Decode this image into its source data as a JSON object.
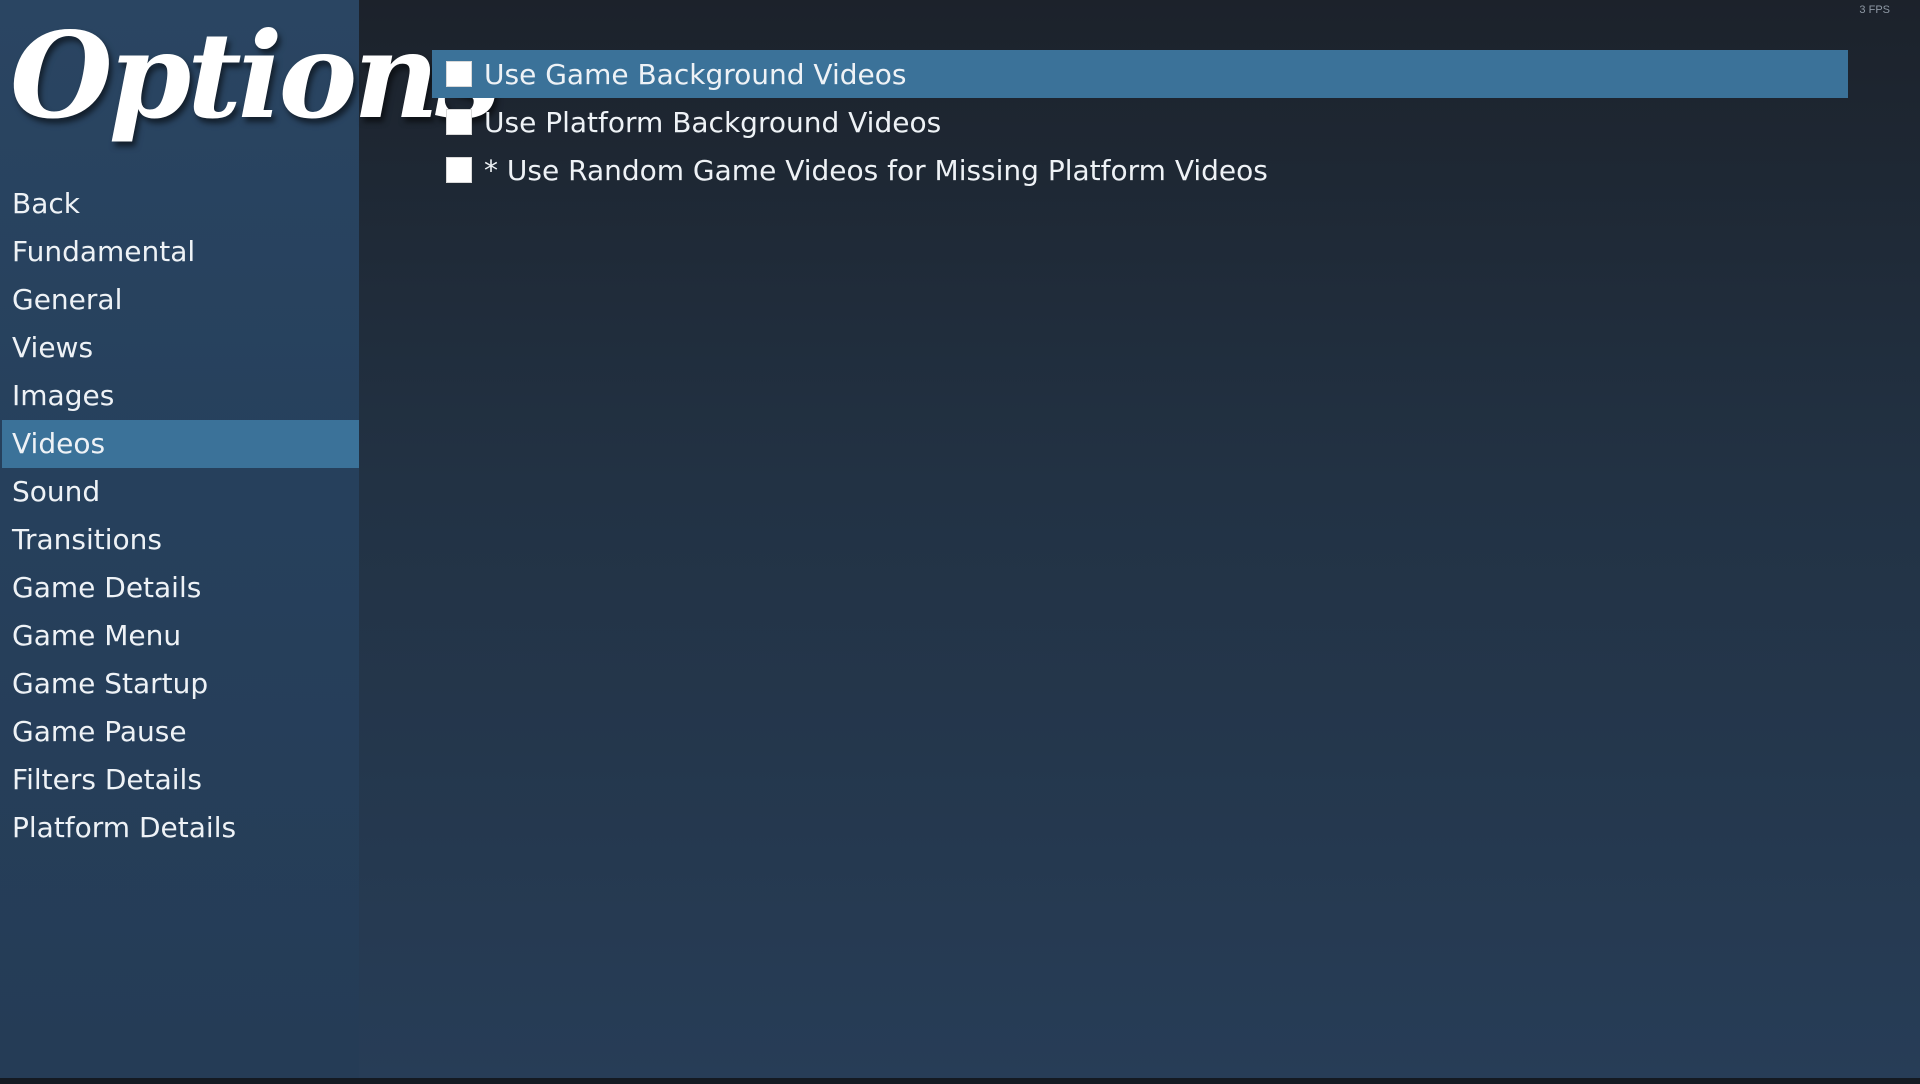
{
  "header": {
    "title": "Options",
    "fps_label": "3 FPS"
  },
  "sidebar": {
    "items": [
      {
        "label": "Back"
      },
      {
        "label": "Fundamental"
      },
      {
        "label": "General"
      },
      {
        "label": "Views"
      },
      {
        "label": "Images"
      },
      {
        "label": "Videos",
        "selected": true
      },
      {
        "label": "Sound"
      },
      {
        "label": "Transitions"
      },
      {
        "label": "Game Details"
      },
      {
        "label": "Game Menu"
      },
      {
        "label": "Game Startup"
      },
      {
        "label": "Game Pause"
      },
      {
        "label": "Filters Details"
      },
      {
        "label": "Platform Details"
      }
    ]
  },
  "main": {
    "options": [
      {
        "label": "Use Game Background Videos",
        "checked": false,
        "highlighted": true
      },
      {
        "label": "Use Platform Background Videos",
        "checked": false
      },
      {
        "label": "* Use Random Game Videos for Missing Platform Videos",
        "checked": false
      }
    ]
  },
  "colors": {
    "highlight": "#3b7299",
    "sidebar_bg": "#26405c",
    "text": "#eef2f6"
  }
}
